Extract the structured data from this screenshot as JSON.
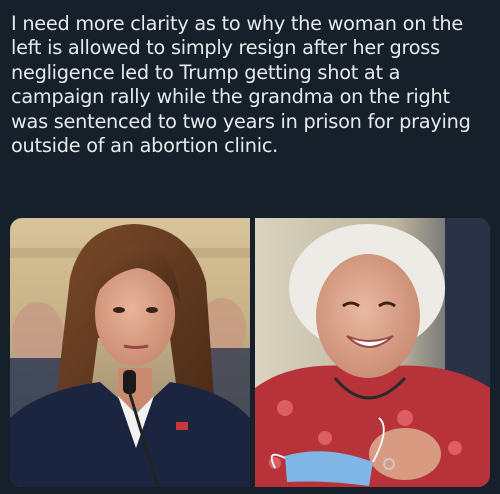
{
  "post": {
    "text": "I need more clarity as to why the woman on the\nleft is allowed to simply resign after her gross\nnegligence led to Trump getting shot at a\ncampaign rally while the grandma on the right\nwas sentenced to two years in prison for praying\noutside of an abortion clinic."
  },
  "media": {
    "images": [
      {
        "icon": "portrait-woman-hearing-photo"
      },
      {
        "icon": "portrait-grandma-photo"
      }
    ]
  },
  "colors": {
    "background": "#15202b",
    "text": "#e7e9ea"
  }
}
